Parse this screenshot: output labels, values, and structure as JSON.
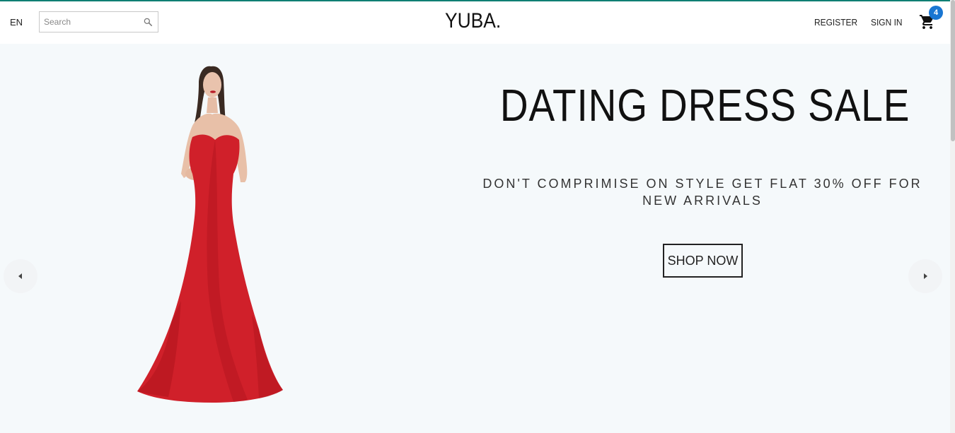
{
  "header": {
    "language": "EN",
    "search": {
      "placeholder": "Search",
      "value": ""
    },
    "logo": "YUBA.",
    "register_label": "REGISTER",
    "signin_label": "SIGN IN",
    "cart_count": "4"
  },
  "hero": {
    "title": "DATING DRESS SALE",
    "subtitle": "DON'T COMPRIMISE ON STYLE GET FLAT 30% OFF FOR NEW ARRIVALS",
    "cta_label": "SHOP NOW"
  },
  "colors": {
    "accent_line": "#0f7f73",
    "badge": "#1976d2",
    "hero_bg": "#f5f9fb",
    "dress": "#d0202a"
  },
  "icons": [
    "search-icon",
    "cart-icon",
    "chevron-left-icon",
    "chevron-right-icon"
  ]
}
